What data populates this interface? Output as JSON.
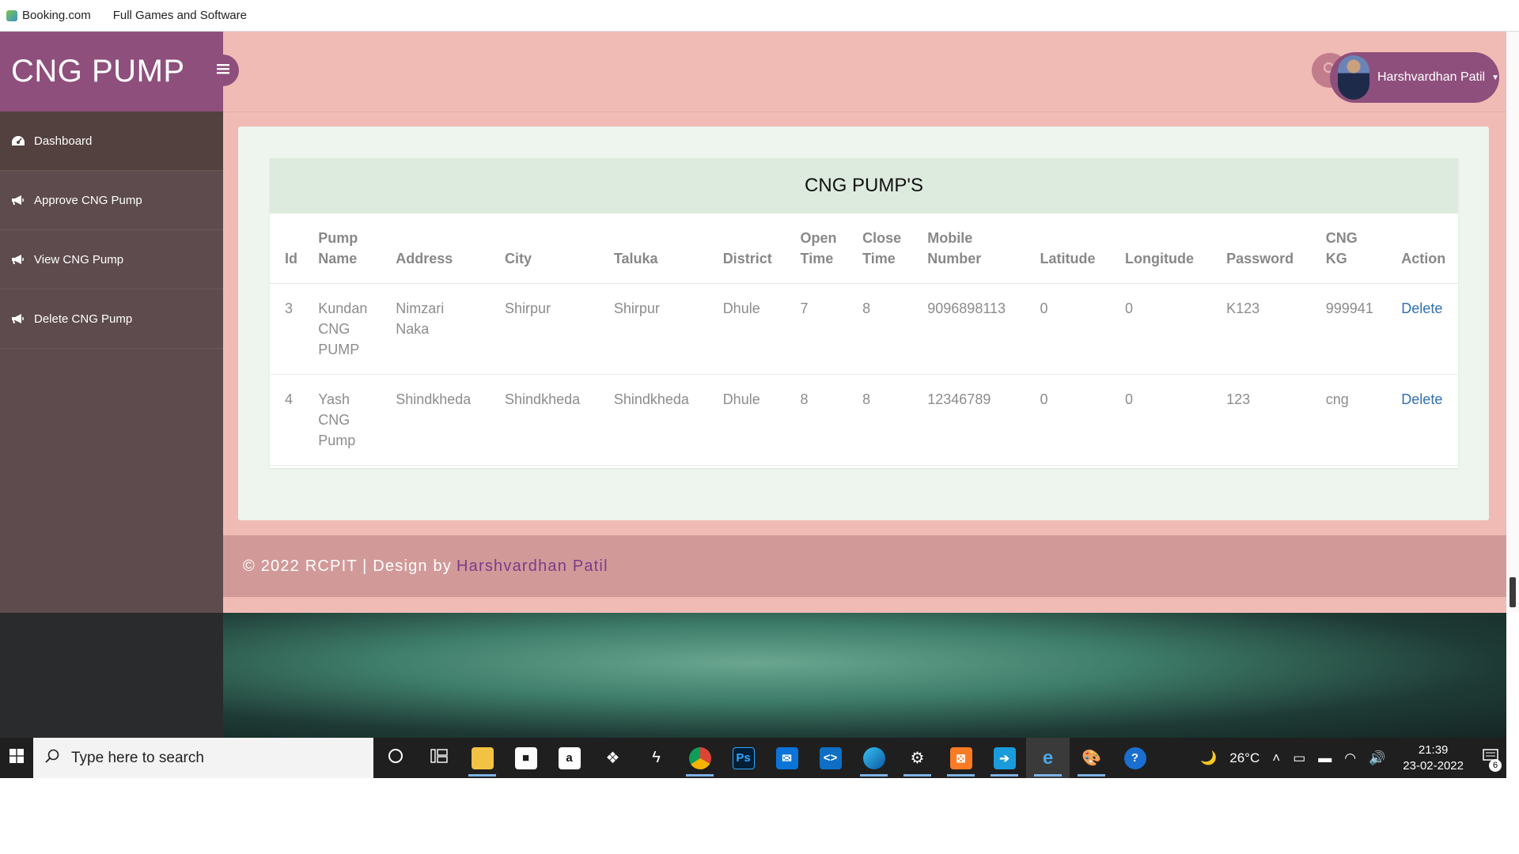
{
  "bookmarks": [
    {
      "label": "Booking.com",
      "icon": "booking-favicon"
    },
    {
      "label": "Full Games and Software",
      "icon": ""
    }
  ],
  "sidebar": {
    "brand": "CNG PUMP",
    "items": [
      {
        "label": "Dashboard",
        "icon": "dashboard-icon"
      },
      {
        "label": "Approve CNG Pump",
        "icon": "megaphone-icon"
      },
      {
        "label": "View CNG Pump",
        "icon": "megaphone-icon"
      },
      {
        "label": "Delete CNG Pump",
        "icon": "megaphone-icon"
      }
    ]
  },
  "header": {
    "user_name": "Harshvardhan Patil"
  },
  "table": {
    "title": "CNG PUMP'S",
    "columns": [
      [
        "Id"
      ],
      [
        "Pump",
        "Name"
      ],
      [
        "Address"
      ],
      [
        "City"
      ],
      [
        "Taluka"
      ],
      [
        "District"
      ],
      [
        "Open",
        "Time"
      ],
      [
        "Close",
        "Time"
      ],
      [
        "Mobile",
        "Number"
      ],
      [
        "Latitude"
      ],
      [
        "Longitude"
      ],
      [
        "Password"
      ],
      [
        "CNG",
        "KG"
      ],
      [
        "Action"
      ]
    ],
    "rows": [
      {
        "id": "3",
        "pump_name": [
          "Kundan",
          "CNG",
          "PUMP"
        ],
        "address": [
          "Nimzari",
          "Naka"
        ],
        "city": "Shirpur",
        "taluka": "Shirpur",
        "district": "Dhule",
        "open_time": "7",
        "close_time": "8",
        "mobile": "9096898113",
        "latitude": "0",
        "longitude": "0",
        "password": "K123",
        "cng_kg": "999941",
        "action": "Delete"
      },
      {
        "id": "4",
        "pump_name": [
          "Yash",
          "CNG",
          "Pump"
        ],
        "address": [
          "Shindkheda"
        ],
        "city": "Shindkheda",
        "taluka": "Shindkheda",
        "district": "Dhule",
        "open_time": "8",
        "close_time": "8",
        "mobile": "12346789",
        "latitude": "0",
        "longitude": "0",
        "password": "123",
        "cng_kg": "cng",
        "action": "Delete"
      }
    ]
  },
  "footer": {
    "text": "© 2022 RCPIT | Design by",
    "link": "Harshvardhan Patil"
  },
  "taskbar": {
    "search_placeholder": "Type here to search",
    "weather": "26°C",
    "time": "21:39",
    "date": "23-02-2022",
    "notification_count": "6"
  },
  "colors": {
    "brand": "#8e4f7c",
    "sidebar": "#5e4b4d",
    "main_bg": "#f0bbb4",
    "footer": "#d19a99",
    "link": "#2f6fb0"
  }
}
